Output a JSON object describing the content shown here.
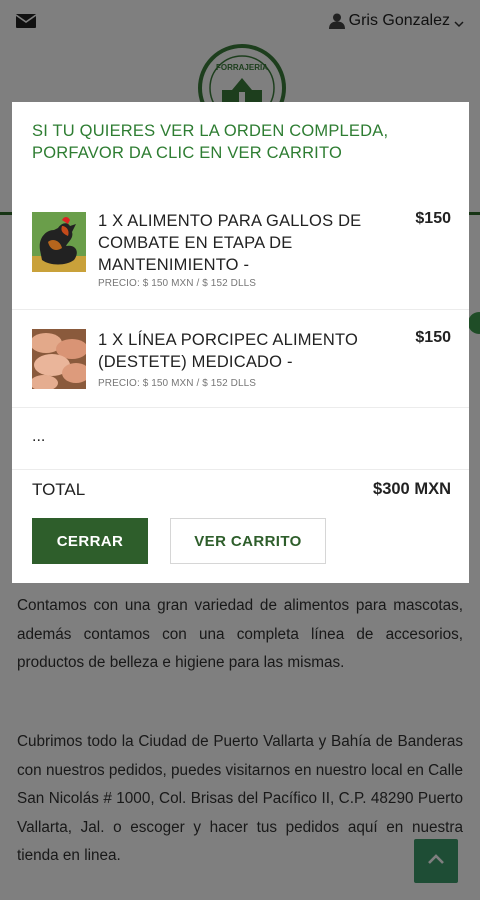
{
  "header": {
    "mail_icon": "mail-icon",
    "user_icon": "user-icon",
    "user_name": "Gris Gonzalez",
    "dropdown_icon": "chevron-down-icon"
  },
  "logo": {
    "text": "FORRAJERIA"
  },
  "page": {
    "paragraph_1": "Contamos con una gran variedad de alimentos para mascotas, además contamos con una completa línea de accesorios, productos de belleza e higiene para las mismas.",
    "paragraph_2": "Cubrimos todo la Ciudad de Puerto Vallarta y Bahía de Banderas con nuestros pedidos, puedes visitarnos en nuestro local en Calle San Nicolás # 1000, Col. Brisas del Pacífico II, C.P. 48290 Puerto Vallarta, Jal. o escoger y hacer tus pedidos aquí en nuestra tienda en linea.",
    "scroll_top_icon": "chevron-up-icon"
  },
  "modal": {
    "message": "SI TU QUIERES VER LA ORDEN COMPLEDA, PORFAVOR DA CLIC EN VER CARRITO",
    "items": [
      {
        "title": "1 X ALIMENTO PARA GALLOS DE COMBATE EN ETAPA DE MANTENIMIENTO -",
        "price": "$150",
        "subtitle": "PRECIO: $ 150 MXN / $ 152 DLLS",
        "image": "rooster-photo"
      },
      {
        "title": "1 X LÍNEA PORCIPEC ALIMENTO (DESTETE) MEDICADO -",
        "price": "$150",
        "subtitle": "PRECIO: $ 150 MXN / $ 152 DLLS",
        "image": "piglets-photo"
      }
    ],
    "more": "...",
    "total_label": "TOTAL",
    "total_value": "$300 MXN",
    "close_button": "CERRAR",
    "cart_button": "VER CARRITO"
  },
  "colors": {
    "brand_green": "#2e5e2b",
    "message_green": "#2e7d32",
    "scroll_button": "#3c9a6b"
  }
}
